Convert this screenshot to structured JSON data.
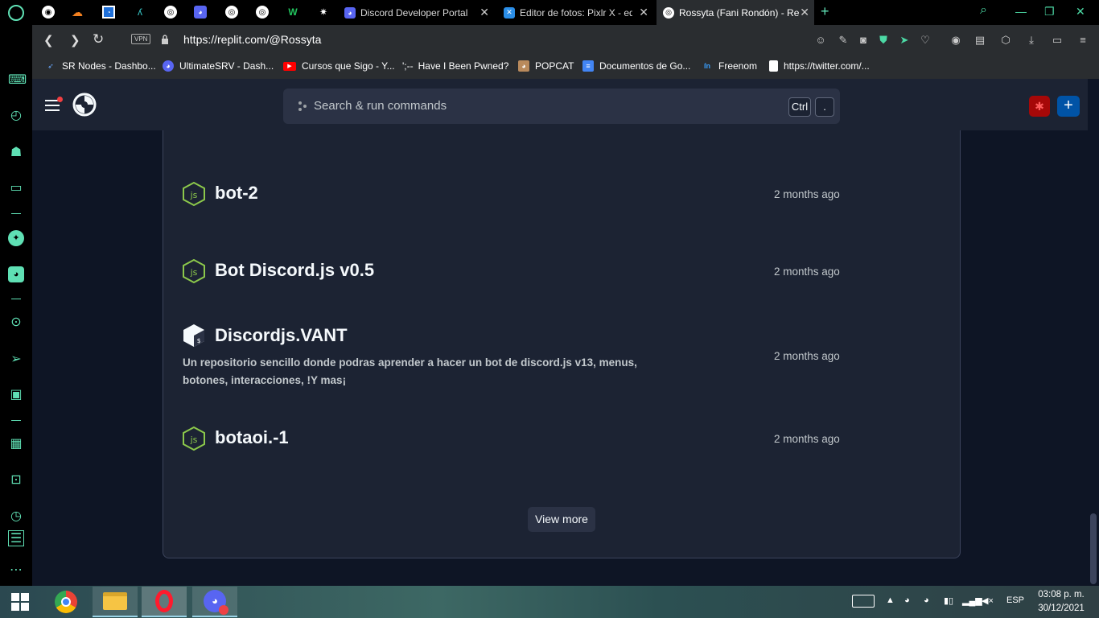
{
  "browser": {
    "tabs": [
      {
        "label": "Discord Developer Portal"
      },
      {
        "label": "Editor de fotos: Pixlr X - edi"
      },
      {
        "label": "Rossyta (Fani Rondón) - Rep"
      }
    ],
    "new_tab": "+",
    "url": "https://replit.com/@Rossyta",
    "vpn": "VPN"
  },
  "bookmarks": [
    {
      "label": "SR Nodes - Dashbo..."
    },
    {
      "label": "UltimateSRV - Dash..."
    },
    {
      "label": "Cursos que Sigo - Y..."
    },
    {
      "label": "Have I Been Pwned?"
    },
    {
      "label": "POPCAT"
    },
    {
      "label": "Documentos de Go..."
    },
    {
      "label": "Freenom"
    },
    {
      "label": "https://twitter.com/..."
    }
  ],
  "bookmark_glyph": "';--",
  "replit": {
    "search_placeholder": "Search & run commands",
    "kbd_ctrl": "Ctrl",
    "kbd_dot": ".",
    "repls": [
      {
        "title": "bot-2",
        "icon": "nodejs-icon",
        "time": "2 months ago",
        "description": ""
      },
      {
        "title": "Bot Discord.js v0.5",
        "icon": "nodejs-icon",
        "time": "2 months ago",
        "description": ""
      },
      {
        "title": "Discordjs.VANT",
        "icon": "bash-icon",
        "time": "2 months ago",
        "description": "Un repositorio sencillo donde podras aprender a hacer un bot de discord.js v13, menus, botones, interacciones, !Y mas¡"
      },
      {
        "title": "botaoi.-1",
        "icon": "nodejs-icon",
        "time": "2 months ago",
        "description": ""
      }
    ],
    "view_more": "View more",
    "colors": {
      "bg": "#0e1525",
      "surface": "#1c2333",
      "control": "#2b3245",
      "node_green": "#8cc84b",
      "accent_blue": "#0053a6",
      "danger": "#a60808"
    }
  },
  "taskbar": {
    "lang": "ESP",
    "time": "03:08 p. m.",
    "date": "30/12/2021"
  }
}
